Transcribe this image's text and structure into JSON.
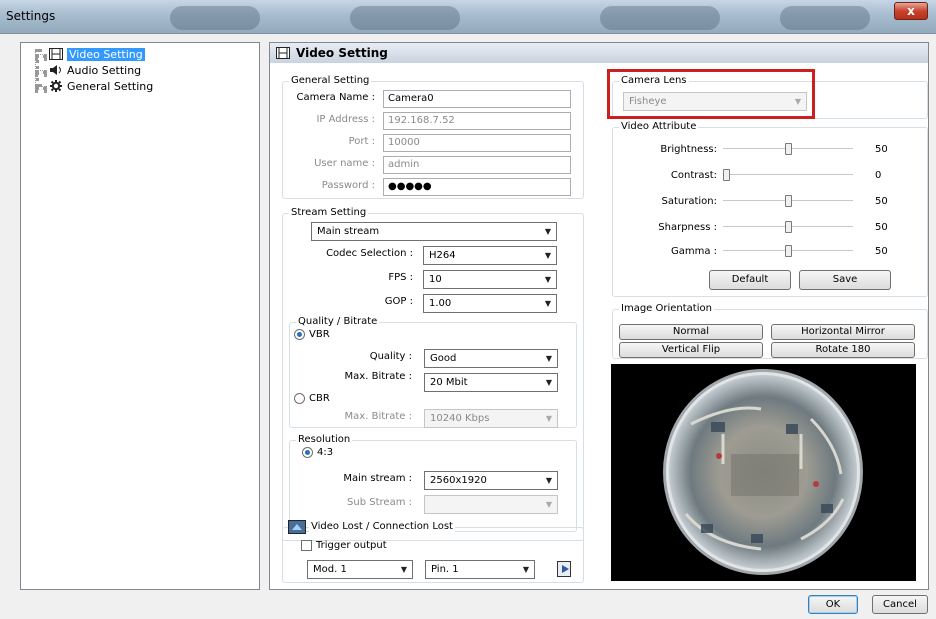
{
  "window": {
    "title": "Settings",
    "close": "x"
  },
  "tree": {
    "items": [
      {
        "label": "Video Setting",
        "icon": "film-icon",
        "selected": true
      },
      {
        "label": "Audio Setting",
        "icon": "speaker-icon",
        "selected": false
      },
      {
        "label": "General Setting",
        "icon": "gear-icon",
        "selected": false
      }
    ]
  },
  "panel": {
    "header": "Video Setting"
  },
  "general": {
    "title": "General Setting",
    "camera_name_label": "Camera Name :",
    "camera_name": "Camera0",
    "ip_label": "IP Address :",
    "ip": "192.168.7.52",
    "port_label": "Port :",
    "port": "10000",
    "user_label": "User name :",
    "user": "admin",
    "password_label": "Password :",
    "password": "●●●●●"
  },
  "stream": {
    "title": "Stream Setting",
    "stream_select": "Main stream",
    "codec_label": "Codec Selection :",
    "codec": "H264",
    "fps_label": "FPS :",
    "fps": "10",
    "gop_label": "GOP :",
    "gop": "1.00"
  },
  "quality": {
    "title": "Quality / Bitrate",
    "vbr": "VBR",
    "quality_label": "Quality :",
    "quality": "Good",
    "max_label": "Max. Bitrate :",
    "max": "20 Mbit",
    "cbr": "CBR",
    "cbr_max_label": "Max. Bitrate :",
    "cbr_max": "10240  Kbps"
  },
  "resolution": {
    "title": "Resolution",
    "ratio": "4:3",
    "main_label": "Main stream :",
    "main": "2560x1920",
    "sub_label": "Sub Stream :",
    "sub": ""
  },
  "videolost": {
    "title": "Video Lost / Connection Lost",
    "trigger": "Trigger output",
    "mod": "Mod. 1",
    "pin": "Pin. 1"
  },
  "lens": {
    "title": "Camera Lens",
    "value": "Fisheye"
  },
  "attr": {
    "title": "Video Attribute",
    "brightness_label": "Brightness:",
    "brightness": 50,
    "contrast_label": "Contrast:",
    "contrast": 0,
    "saturation_label": "Saturation:",
    "saturation": 50,
    "sharpness_label": "Sharpness :",
    "sharpness": 50,
    "gamma_label": "Gamma :",
    "gamma": 50,
    "default_btn": "Default",
    "save_btn": "Save"
  },
  "orientation": {
    "title": "Image Orientation",
    "normal": "Normal",
    "hmirror": "Horizontal Mirror",
    "vflip": "Vertical Flip",
    "rotate": "Rotate 180"
  },
  "footer": {
    "ok": "OK",
    "cancel": "Cancel"
  },
  "colors": {
    "highlight": "#cc1f1f",
    "selection": "#3399ff"
  }
}
